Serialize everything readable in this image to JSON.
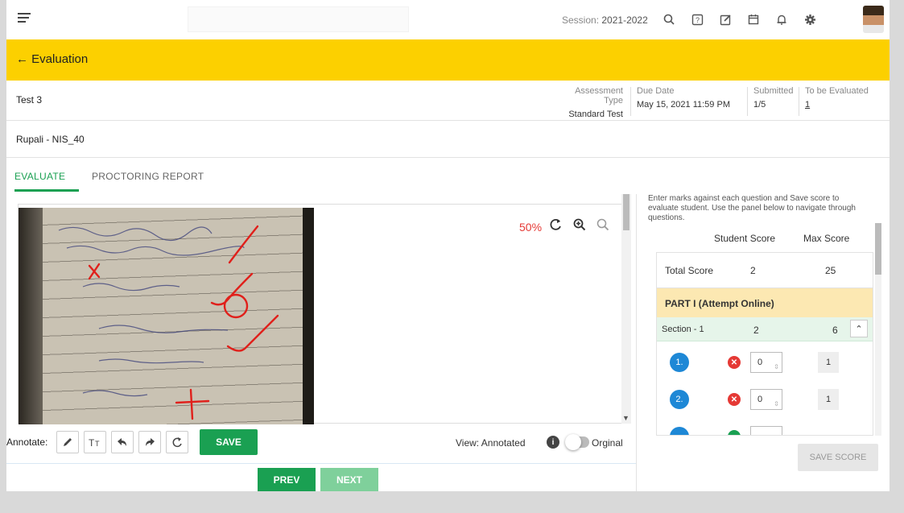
{
  "topbar": {
    "session_label": "Session:",
    "session_value": "2021-2022",
    "icons": [
      "search-icon",
      "help-icon",
      "edit-icon",
      "calendar-icon",
      "bell-icon",
      "gear-icon"
    ]
  },
  "header": {
    "back_label": "← Evaluation",
    "accent": "#fcd000"
  },
  "assessment": {
    "title": "Test 3",
    "type_label": "Assessment Type",
    "type_value": "Standard Test",
    "due_label": "Due Date",
    "due_value": "May 15, 2021 11:59 PM",
    "submitted_label": "Submitted",
    "submitted_value": "1/5",
    "tobe_label": "To be Evaluated",
    "tobe_value": "1"
  },
  "student": {
    "name": "Rupali - NIS_40"
  },
  "tabs": [
    {
      "label": "EVALUATE",
      "active": true
    },
    {
      "label": "PROCTORING REPORT",
      "active": false
    }
  ],
  "viewer": {
    "zoom": "50%"
  },
  "annotate": {
    "label": "Annotate:",
    "save_label": "SAVE",
    "view_label": "View: Annotated",
    "original_label": "Orginal"
  },
  "nav": {
    "prev_label": "PREV",
    "next_label": "NEXT"
  },
  "panel": {
    "instructions": "Enter marks against each question and Save score to evaluate student. Use the panel below to navigate through questions.",
    "student_score_header": "Student Score",
    "max_score_header": "Max Score",
    "total_label": "Total Score",
    "total_student": "2",
    "total_max": "25",
    "part_label": "PART I (Attempt Online)",
    "section_label": "Section - 1",
    "section_student": "2",
    "section_max": "6",
    "questions": [
      {
        "num": "1.",
        "score": "0",
        "max": "1",
        "status": "wrong"
      },
      {
        "num": "2.",
        "score": "0",
        "max": "1",
        "status": "wrong"
      }
    ],
    "save_score_label": "SAVE SCORE"
  },
  "colors": {
    "green": "#1aa052",
    "red": "#e53935",
    "blue": "#1e88d6",
    "part_bg": "#fce8b2",
    "section_bg": "#e6f5ea"
  }
}
